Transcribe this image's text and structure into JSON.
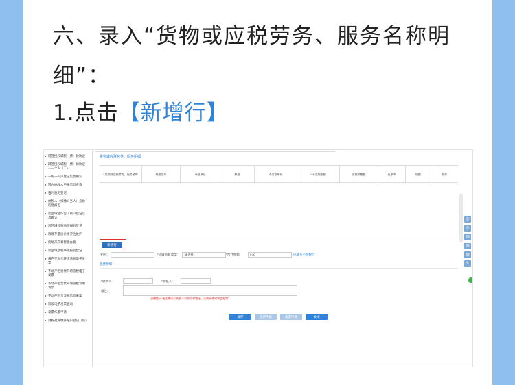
{
  "heading": "六、录入“货物或应税劳务、服务名称明细”：",
  "step": {
    "prefix": "1.点击",
    "highlight": "【新增行】"
  },
  "sidebar": {
    "items": [
      "网签授权城税（费）款协议",
      "网签授权城税（费）款协议——个人（二）",
      "一照一码户登记信息确认",
      "转办纳税人申报信息查询",
      "临时税务登记",
      "纳税人（扣缴义务人）身份信息报告",
      "跨区域合作企工商户登记信息确认",
      "跨区域涉税事项报验登记",
      "跨境存量房价格评估维护",
      "房地产交易智能办税",
      "跨区域涉税事项报验登记",
      "增产交易代开增值税电子发票",
      "不动产租赁代开增值税电子发票",
      "不动产租赁代开增值税专用发票",
      "不动产租赁涉税信息采集",
      "跨境电子发票查询",
      "发票作废申请",
      "财税社保缴存账户登记（新）"
    ]
  },
  "main": {
    "tab_label": "货物或应税劳务、服务明细",
    "columns": [
      "* 货物或应税劳务、服务名称",
      "规格型号",
      "计量单位",
      "数量",
      "不含税单价",
      "* 不含税金额",
      "含税销售额",
      "征收率",
      "税额",
      "操作"
    ],
    "add_row_label": "新增行",
    "industry_label": "*行业:",
    "industry_value": "",
    "levy_type_label": "*征收品目类型:",
    "levy_type_value": "-请选择-",
    "total_label": "*合计金额:",
    "total_value": "0.00",
    "total_link": "已填写不含税价",
    "tax_detail_link": "税费明细",
    "payee_label": "*收款人:",
    "reviewer_label": "*复核人:",
    "remark_label": "备注:",
    "warning": "温馨提示:备注需填写纳税人识别号和地址，否则开票时将会报错！",
    "buttons": [
      "保存",
      "暂存申报",
      "发票申请",
      "关闭"
    ]
  }
}
